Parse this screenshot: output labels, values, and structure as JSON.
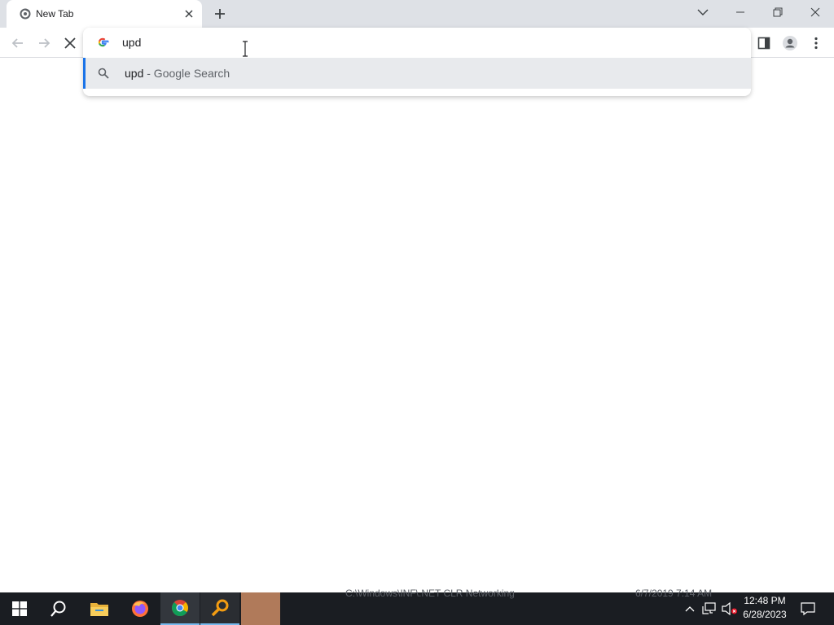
{
  "tab": {
    "title": "New Tab",
    "favicon": "chrome-loading-icon"
  },
  "window_controls": [
    "tab-search-icon",
    "minimize-icon",
    "restore-icon",
    "close-icon"
  ],
  "toolbar": {
    "buttons": [
      "back-arrow-icon",
      "forward-arrow-icon",
      "stop-icon",
      "side-panel-icon",
      "profile-icon",
      "kebab-menu-icon"
    ]
  },
  "omnibox": {
    "value": "upd",
    "engine_icon": "google-g-icon"
  },
  "suggestions": [
    {
      "query": "upd",
      "separator": " - Google Search",
      "icon": "search-icon"
    }
  ],
  "taskbar": {
    "apps": [
      "windows-start-icon",
      "search-icon",
      "file-explorer-icon",
      "firefox-icon",
      "chrome-icon",
      "key-search-icon",
      "app-icon"
    ],
    "ghost_text": [
      "C:\\Windows\\INF\\.NET CLR Networking",
      "6/7/2019 7:14 AM"
    ]
  },
  "clock": {
    "time": "12:48 PM",
    "date": "6/28/2023"
  },
  "colors": {
    "tabstrip": "#dee1e6",
    "accent": "#1a73e8",
    "taskbar": "#1a1d22",
    "suggestion_highlight": "#e8eaed"
  }
}
